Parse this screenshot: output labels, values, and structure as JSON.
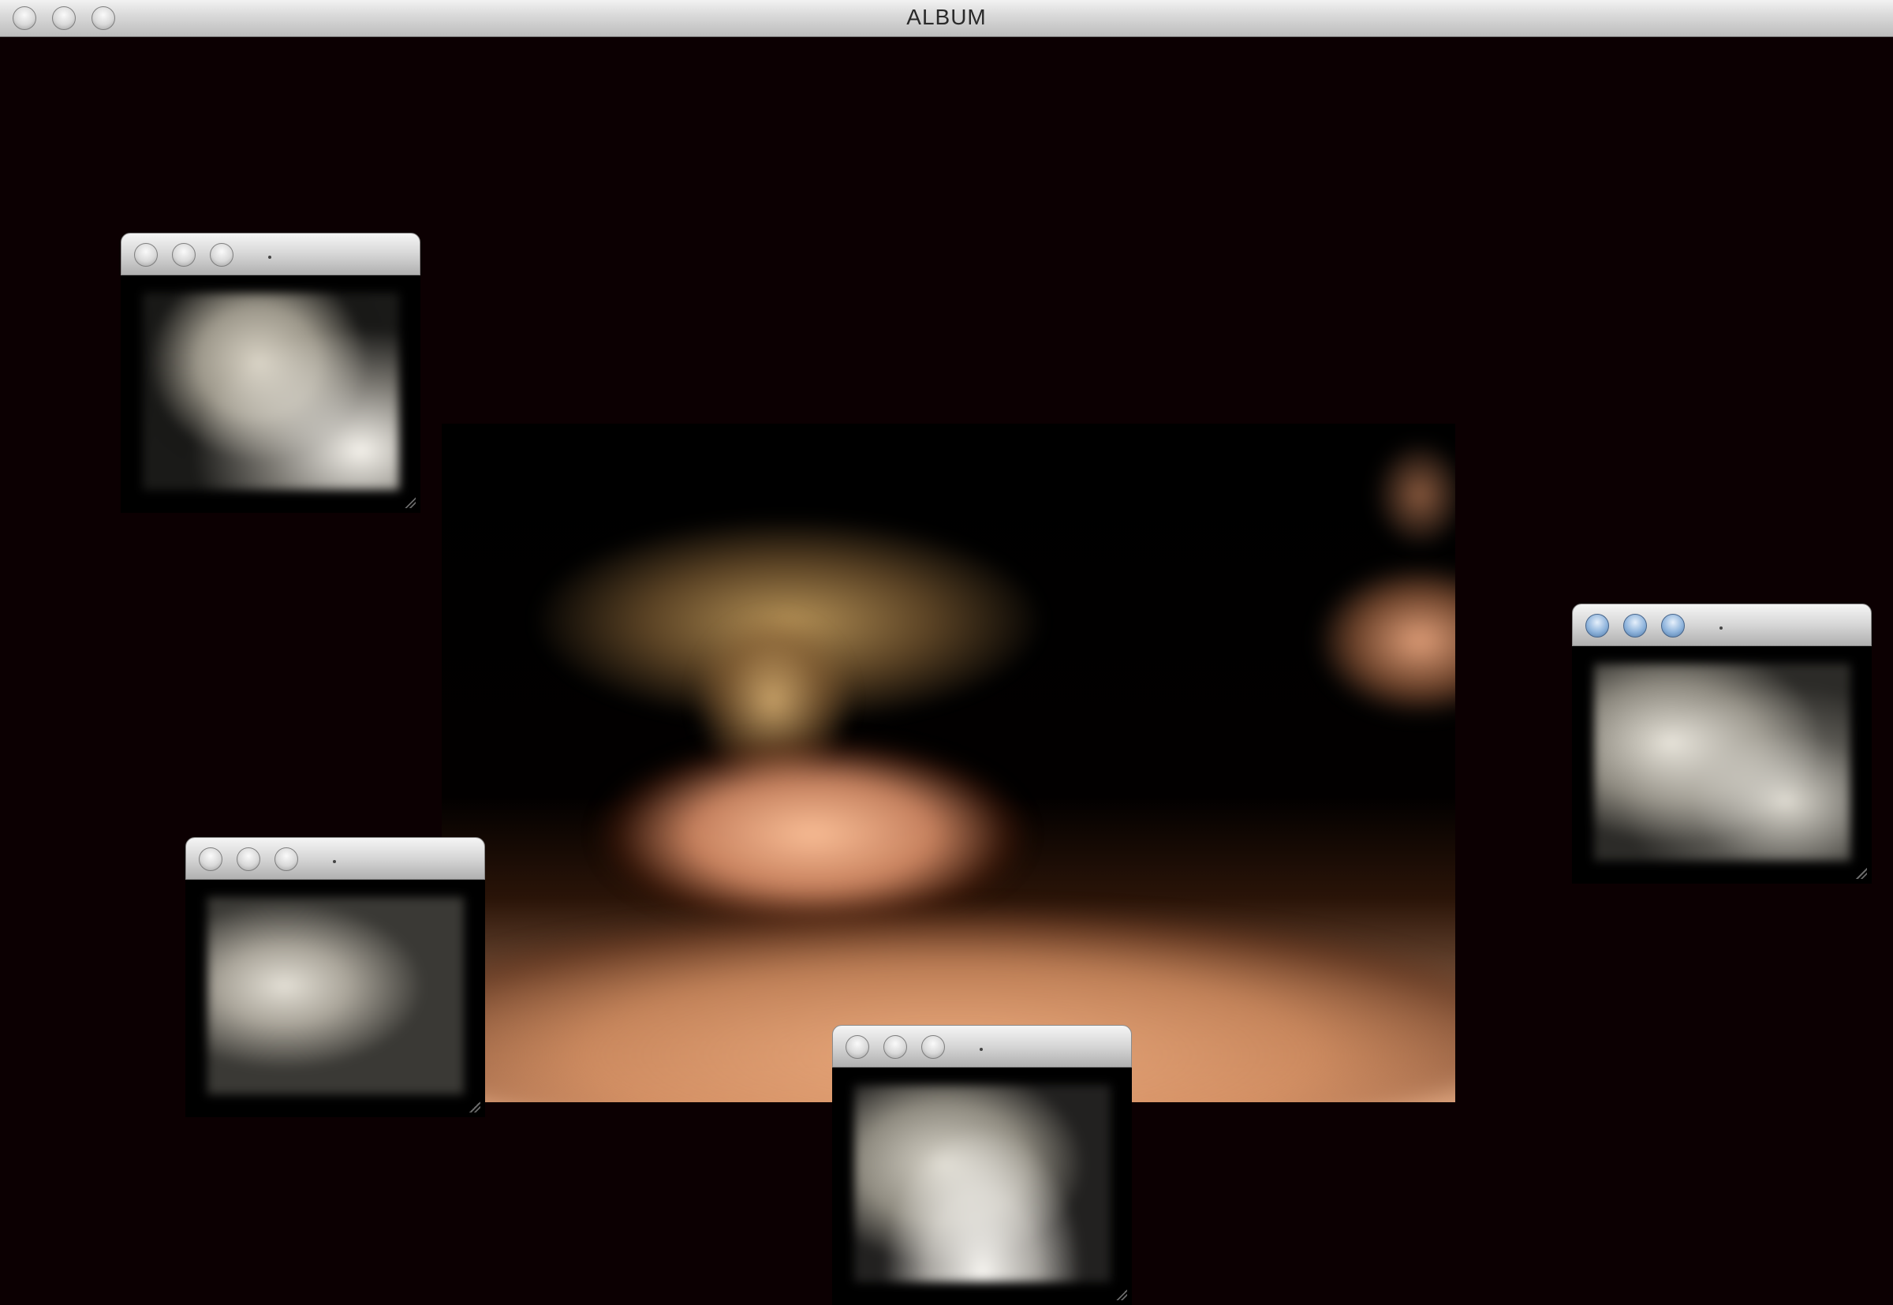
{
  "window": {
    "title": "ALBUM"
  },
  "main_photo": {
    "icon": "ballerina-photo"
  },
  "mini_windows": [
    {
      "title": ".",
      "icon": "photo-thumbnail"
    },
    {
      "title": ".",
      "icon": "photo-thumbnail"
    },
    {
      "title": ".",
      "icon": "photo-thumbnail"
    },
    {
      "title": ".",
      "icon": "photo-thumbnail"
    }
  ],
  "colors": {
    "background": "#0c0002",
    "titlebar_light": "#f2f2f2",
    "titlebar_dark": "#bdbdbd",
    "button_blue": "#8fb4dc",
    "photo_skin": "#d9a07a"
  }
}
